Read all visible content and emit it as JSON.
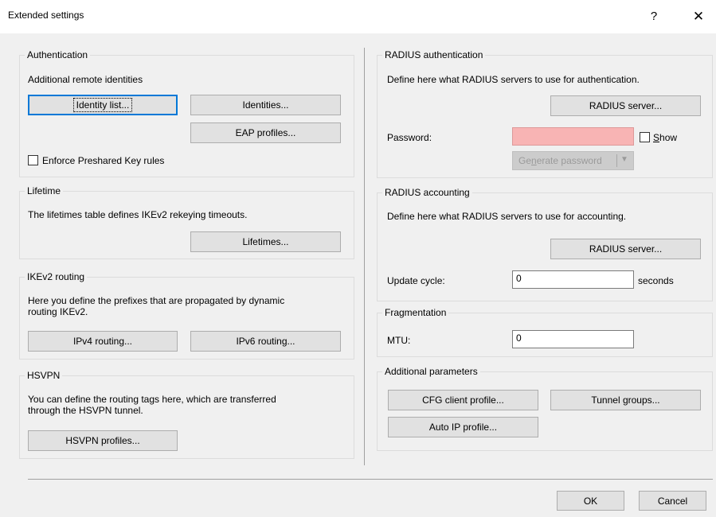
{
  "window": {
    "title": "Extended settings",
    "help_label": "?",
    "close_label": "✕"
  },
  "left": {
    "authentication": {
      "legend": "Authentication",
      "description": "Additional remote identities",
      "identity_list_button": "Identity list...",
      "identities_button": "Identities...",
      "eap_profiles_button": "EAP profiles...",
      "enforce_psk_label": "Enforce Preshared Key rules",
      "enforce_psk_checked": false
    },
    "lifetime": {
      "legend": "Lifetime",
      "description": "The lifetimes table defines IKEv2 rekeying timeouts.",
      "lifetimes_button": "Lifetimes..."
    },
    "ikev2_routing": {
      "legend": "IKEv2 routing",
      "description_line1": "Here you define the prefixes that are propagated by dynamic",
      "description_line2": "routing IKEv2.",
      "ipv4_button": "IPv4 routing...",
      "ipv6_button": "IPv6 routing..."
    },
    "hsvpn": {
      "legend": "HSVPN",
      "description_line1": "You can define the routing tags here, which are transferred",
      "description_line2": "through the HSVPN tunnel.",
      "profiles_button": "HSVPN profiles..."
    }
  },
  "right": {
    "radius_auth": {
      "legend": "RADIUS authentication",
      "description": "Define here what RADIUS servers to use for authentication.",
      "server_button": "RADIUS server...",
      "password_label": "Password:",
      "password_value": "",
      "password_field_color": "#f8b4b4",
      "show_label_prefix": "",
      "show_label_underlined": "S",
      "show_label_rest": "how",
      "show_checked": false,
      "generate_prefix": "Ge",
      "generate_underlined": "n",
      "generate_rest": "erate password",
      "generate_arrow": "▼"
    },
    "radius_accounting": {
      "legend": "RADIUS accounting",
      "description": "Define here what RADIUS servers to use for accounting.",
      "server_button": "RADIUS server...",
      "update_cycle_label": "Update cycle:",
      "update_cycle_value": "0",
      "update_cycle_unit": "seconds"
    },
    "fragmentation": {
      "legend": "Fragmentation",
      "mtu_label": "MTU:",
      "mtu_value": "0"
    },
    "additional": {
      "legend": "Additional parameters",
      "cfg_client_button": "CFG client profile...",
      "tunnel_groups_button": "Tunnel groups...",
      "auto_ip_button": "Auto IP profile..."
    }
  },
  "footer": {
    "ok_button": "OK",
    "cancel_button": "Cancel"
  },
  "colors": {
    "accent": "#0078d7",
    "dialog_bg": "#f0f0f0",
    "titlebar_bg": "#ffffff"
  }
}
